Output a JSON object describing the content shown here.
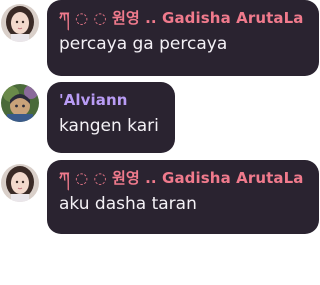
{
  "colors": {
    "bubble_bg": "#2a2330",
    "name_pink": "#f07a8c",
    "name_purple": "#b99cf5",
    "text": "#f4f1f6"
  },
  "messages": [
    {
      "avatar_icon": "girl-portrait-avatar-icon",
      "author": "ཀ ◌ ◌ 원영 .. Gadisha ArutaLa",
      "name_color": "#f07a8c",
      "text": "percaya ga percaya"
    },
    {
      "avatar_icon": "character-avatar-icon",
      "author": "'Alviann",
      "name_color": "#b99cf5",
      "text": "kangen kari"
    },
    {
      "avatar_icon": "girl-portrait-avatar-icon",
      "author": "ཀ ◌ ◌ 원영 .. Gadisha ArutaLa",
      "name_color": "#f07a8c",
      "text": "aku dasha taran"
    }
  ]
}
